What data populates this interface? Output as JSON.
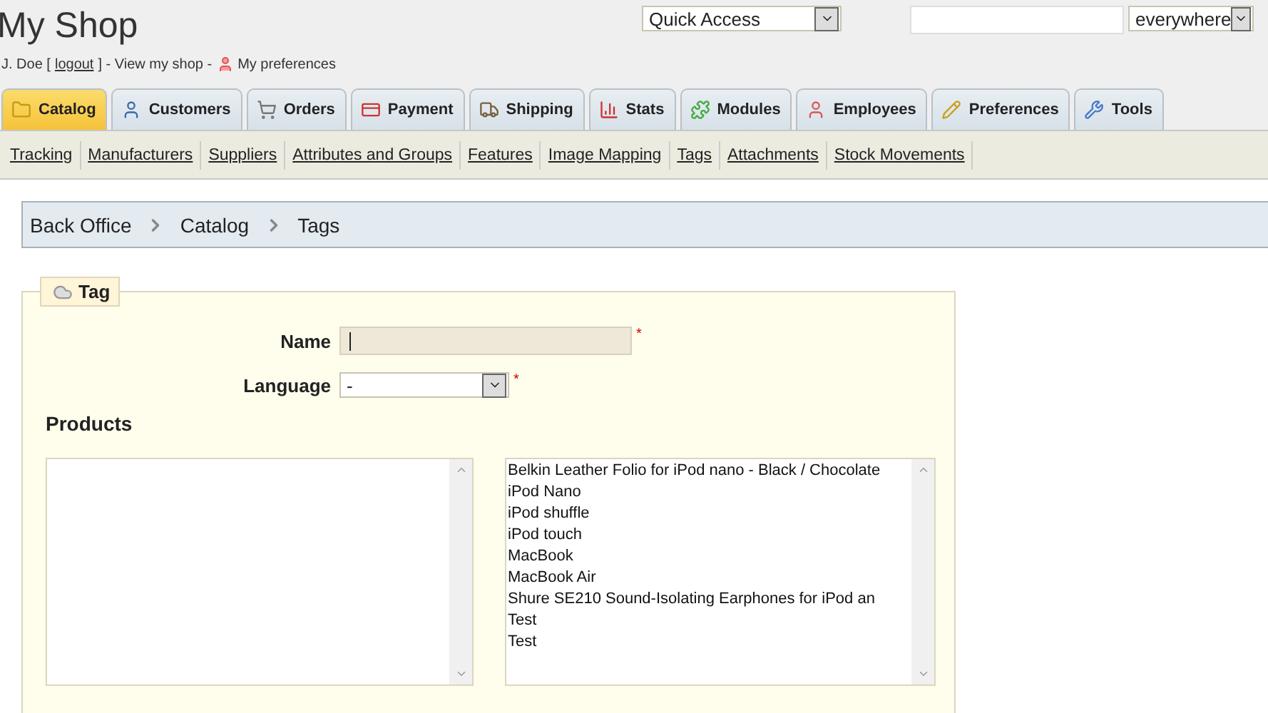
{
  "header": {
    "shop_title": "My Shop",
    "user_line": {
      "name": "J. Doe [",
      "logout": "logout",
      "after": "] - View my shop -",
      "preferences": "My preferences"
    },
    "quick_access": {
      "value": "Quick Access"
    },
    "search": {
      "scope": "everywhere"
    }
  },
  "tabs": [
    {
      "label": "Catalog",
      "selected": true
    },
    {
      "label": "Customers",
      "selected": false
    },
    {
      "label": "Orders",
      "selected": false
    },
    {
      "label": "Payment",
      "selected": false
    },
    {
      "label": "Shipping",
      "selected": false
    },
    {
      "label": "Stats",
      "selected": false
    },
    {
      "label": "Modules",
      "selected": false
    },
    {
      "label": "Employees",
      "selected": false
    },
    {
      "label": "Preferences",
      "selected": false
    },
    {
      "label": "Tools",
      "selected": false
    }
  ],
  "submenu": [
    "Tracking",
    "Manufacturers",
    "Suppliers",
    "Attributes and Groups",
    "Features",
    "Image Mapping",
    "Tags",
    "Attachments",
    "Stock Movements"
  ],
  "breadcrumb": [
    "Back Office",
    "Catalog",
    "Tags"
  ],
  "form": {
    "legend": "Tag",
    "name_label": "Name",
    "language_label": "Language",
    "language_value": "-",
    "required_mark": "*",
    "products_label": "Products",
    "available_products": [
      "Belkin Leather Folio for iPod nano - Black / Chocolate",
      "iPod Nano",
      "iPod shuffle",
      "iPod touch",
      "MacBook",
      "MacBook Air",
      "Shure SE210 Sound-Isolating Earphones for iPod an",
      "Test",
      "Test"
    ]
  }
}
